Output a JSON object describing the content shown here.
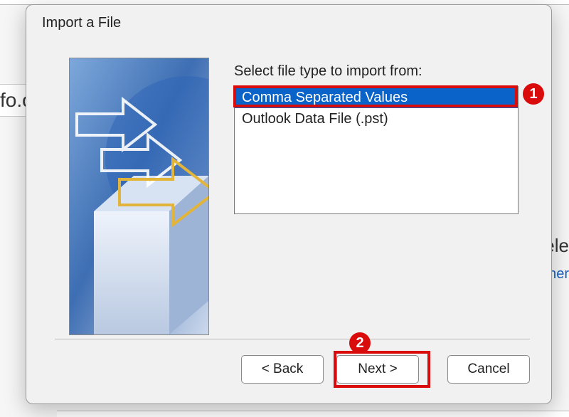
{
  "background": {
    "fo_text": "fo.c",
    "ele_text": "ele",
    "her_text": "her"
  },
  "dialog": {
    "title": "Import a File",
    "prompt": "Select file type to import from:",
    "options": [
      "Comma Separated Values",
      "Outlook Data File (.pst)"
    ],
    "selected_index": 0,
    "buttons": {
      "back": "< Back",
      "next": "Next >",
      "cancel": "Cancel"
    }
  },
  "annotations": {
    "marker1": "1",
    "marker2": "2"
  }
}
